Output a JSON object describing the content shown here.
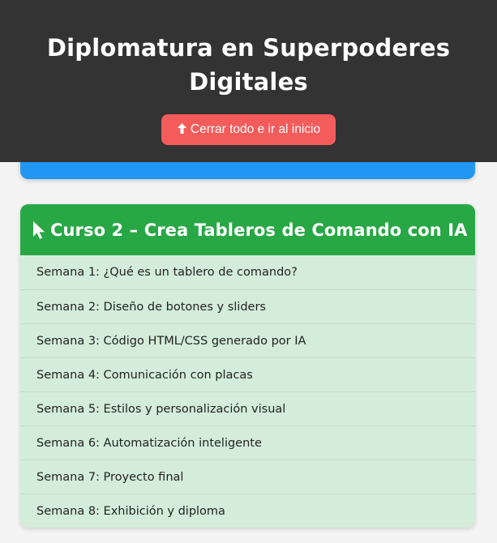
{
  "header": {
    "title": "Diplomatura en Superpoderes Digitales",
    "button_icon": "arrow-up-icon",
    "button_label": "Cerrar todo e ir al inicio",
    "background_color": "#333333",
    "button_color": "#f45b5b"
  },
  "previous_card": {
    "color": "#2196f3"
  },
  "course": {
    "icon": "cursor-pointer-icon",
    "title": "Curso 2 – Crea Tableros de Comando con IA",
    "header_color": "#28a745",
    "body_color": "#d4edda",
    "weeks": [
      "Semana 1: ¿Qué es un tablero de comando?",
      "Semana 2: Diseño de botones y sliders",
      "Semana 3: Código HTML/CSS generado por IA",
      "Semana 4: Comunicación con placas",
      "Semana 5: Estilos y personalización visual",
      "Semana 6: Automatización inteligente",
      "Semana 7: Proyecto final",
      "Semana 8: Exhibición y diploma"
    ]
  }
}
